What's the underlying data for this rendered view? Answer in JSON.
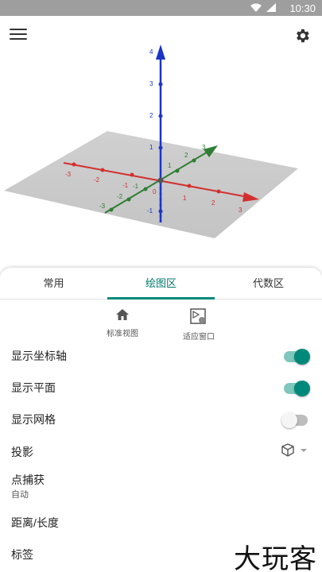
{
  "status_bar": {
    "time": "10:30"
  },
  "graphics_3d": {
    "z_ticks": [
      "4",
      "3",
      "2",
      "1",
      "-1"
    ],
    "x_ticks": [
      "-3",
      "-2",
      "-1",
      "0",
      "1",
      "2",
      "3"
    ],
    "y_ticks": [
      "-3",
      "-2",
      "-1",
      "1",
      "2",
      "3"
    ],
    "axis_colors": {
      "x": "#d32f2f",
      "y": "#2e7d32",
      "z": "#1a35c8"
    }
  },
  "tabs": [
    {
      "label": "常用"
    },
    {
      "label": "绘图区"
    },
    {
      "label": "代数区"
    }
  ],
  "active_tab": "绘图区",
  "view_buttons": {
    "standard_view": "标准视图",
    "fit_window": "适应窗口"
  },
  "settings": {
    "show_axes": {
      "label": "显示坐标轴",
      "on": true
    },
    "show_plane": {
      "label": "显示平面",
      "on": true
    },
    "show_grid": {
      "label": "显示网格",
      "on": false
    },
    "projection": {
      "label": "投影"
    },
    "point_capture": {
      "label": "点捕获",
      "value": "自动"
    },
    "distance": {
      "label": "距离/长度"
    },
    "labels": {
      "label": "标签"
    }
  },
  "watermark": "大玩客",
  "accent_color": "#00897b"
}
